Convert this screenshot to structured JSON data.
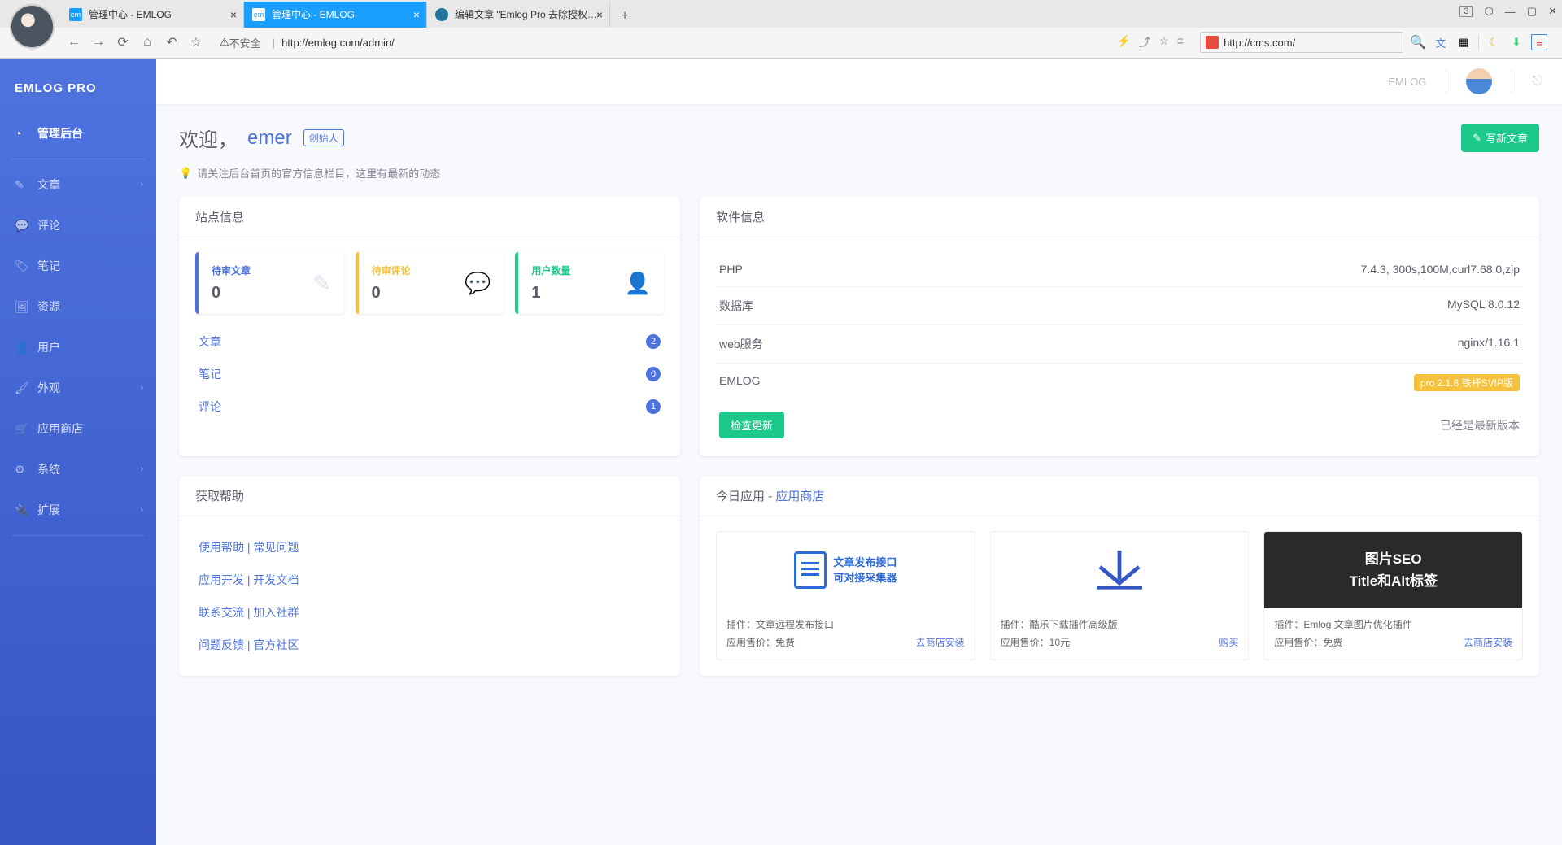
{
  "browser": {
    "tabs": [
      {
        "title": "管理中心 - EMLOG",
        "favicon": "em"
      },
      {
        "title": "管理中心 - EMLOG",
        "favicon": "em",
        "active": true
      },
      {
        "title": "编辑文章 \"Emlog Pro 去除授权…",
        "favicon": "wp"
      }
    ],
    "tab_count_badge": "3",
    "url_insecure": "不安全",
    "url": "http://emlog.com/admin/",
    "ext_url": "http://cms.com/"
  },
  "sidebar": {
    "brand": "EMLOG PRO",
    "items": [
      {
        "icon": "◔",
        "label": "管理后台",
        "active": true
      },
      {
        "icon": "✎",
        "label": "文章",
        "chev": true
      },
      {
        "icon": "💬",
        "label": "评论"
      },
      {
        "icon": "🏷",
        "label": "笔记"
      },
      {
        "icon": "🖼",
        "label": "资源"
      },
      {
        "icon": "👤",
        "label": "用户"
      },
      {
        "icon": "🖌",
        "label": "外观",
        "chev": true
      },
      {
        "icon": "🛒",
        "label": "应用商店"
      },
      {
        "icon": "⚙",
        "label": "系统",
        "chev": true
      },
      {
        "icon": "🔌",
        "label": "扩展",
        "chev": true
      }
    ]
  },
  "topbar": {
    "user": "EMLOG"
  },
  "page": {
    "welcome_prefix": "欢迎，",
    "username": "emer",
    "role": "创始人",
    "write_btn": "写新文章",
    "tip": "请关注后台首页的官方信息栏目，这里有最新的动态"
  },
  "site_info": {
    "title": "站点信息",
    "stats": [
      {
        "label": "待审文章",
        "value": "0",
        "color": "blue",
        "icon": "✎"
      },
      {
        "label": "待审评论",
        "value": "0",
        "color": "yellow",
        "icon": "💬"
      },
      {
        "label": "用户数量",
        "value": "1",
        "color": "green",
        "icon": "👤"
      }
    ],
    "list": [
      {
        "label": "文章",
        "count": "2"
      },
      {
        "label": "笔记",
        "count": "0"
      },
      {
        "label": "评论",
        "count": "1"
      }
    ]
  },
  "software": {
    "title": "软件信息",
    "rows": [
      {
        "k": "PHP",
        "v": "7.4.3, 300s,100M,curl7.68.0,zip"
      },
      {
        "k": "数据库",
        "v": "MySQL 8.0.12"
      },
      {
        "k": "web服务",
        "v": "nginx/1.16.1"
      },
      {
        "k": "EMLOG",
        "v": "pro 2.1.8 铁杆SVIP版",
        "badge": true
      }
    ],
    "check_btn": "检查更新",
    "update_status": "已经是最新版本"
  },
  "help": {
    "title": "获取帮助",
    "links": [
      "使用帮助 | 常见问题",
      "应用开发 | 开发文档",
      "联系交流 | 加入社群",
      "问题反馈 | 官方社区"
    ]
  },
  "apps": {
    "title_prefix": "今日应用 - ",
    "store_link": "应用商店",
    "items": [
      {
        "thumb_line1": "文章发布接口",
        "thumb_line2": "可对接采集器",
        "name": "插件：文章远程发布接口",
        "price": "应用售价：免费",
        "action": "去商店安装"
      },
      {
        "name": "插件：酷乐下载插件高级版",
        "price": "应用售价：10元",
        "action": "购买"
      },
      {
        "thumb_line1": "图片SEO",
        "thumb_line2": "Title和Alt标签",
        "name": "插件：Emlog 文章图片优化插件",
        "price": "应用售价：免费",
        "action": "去商店安装"
      }
    ]
  }
}
